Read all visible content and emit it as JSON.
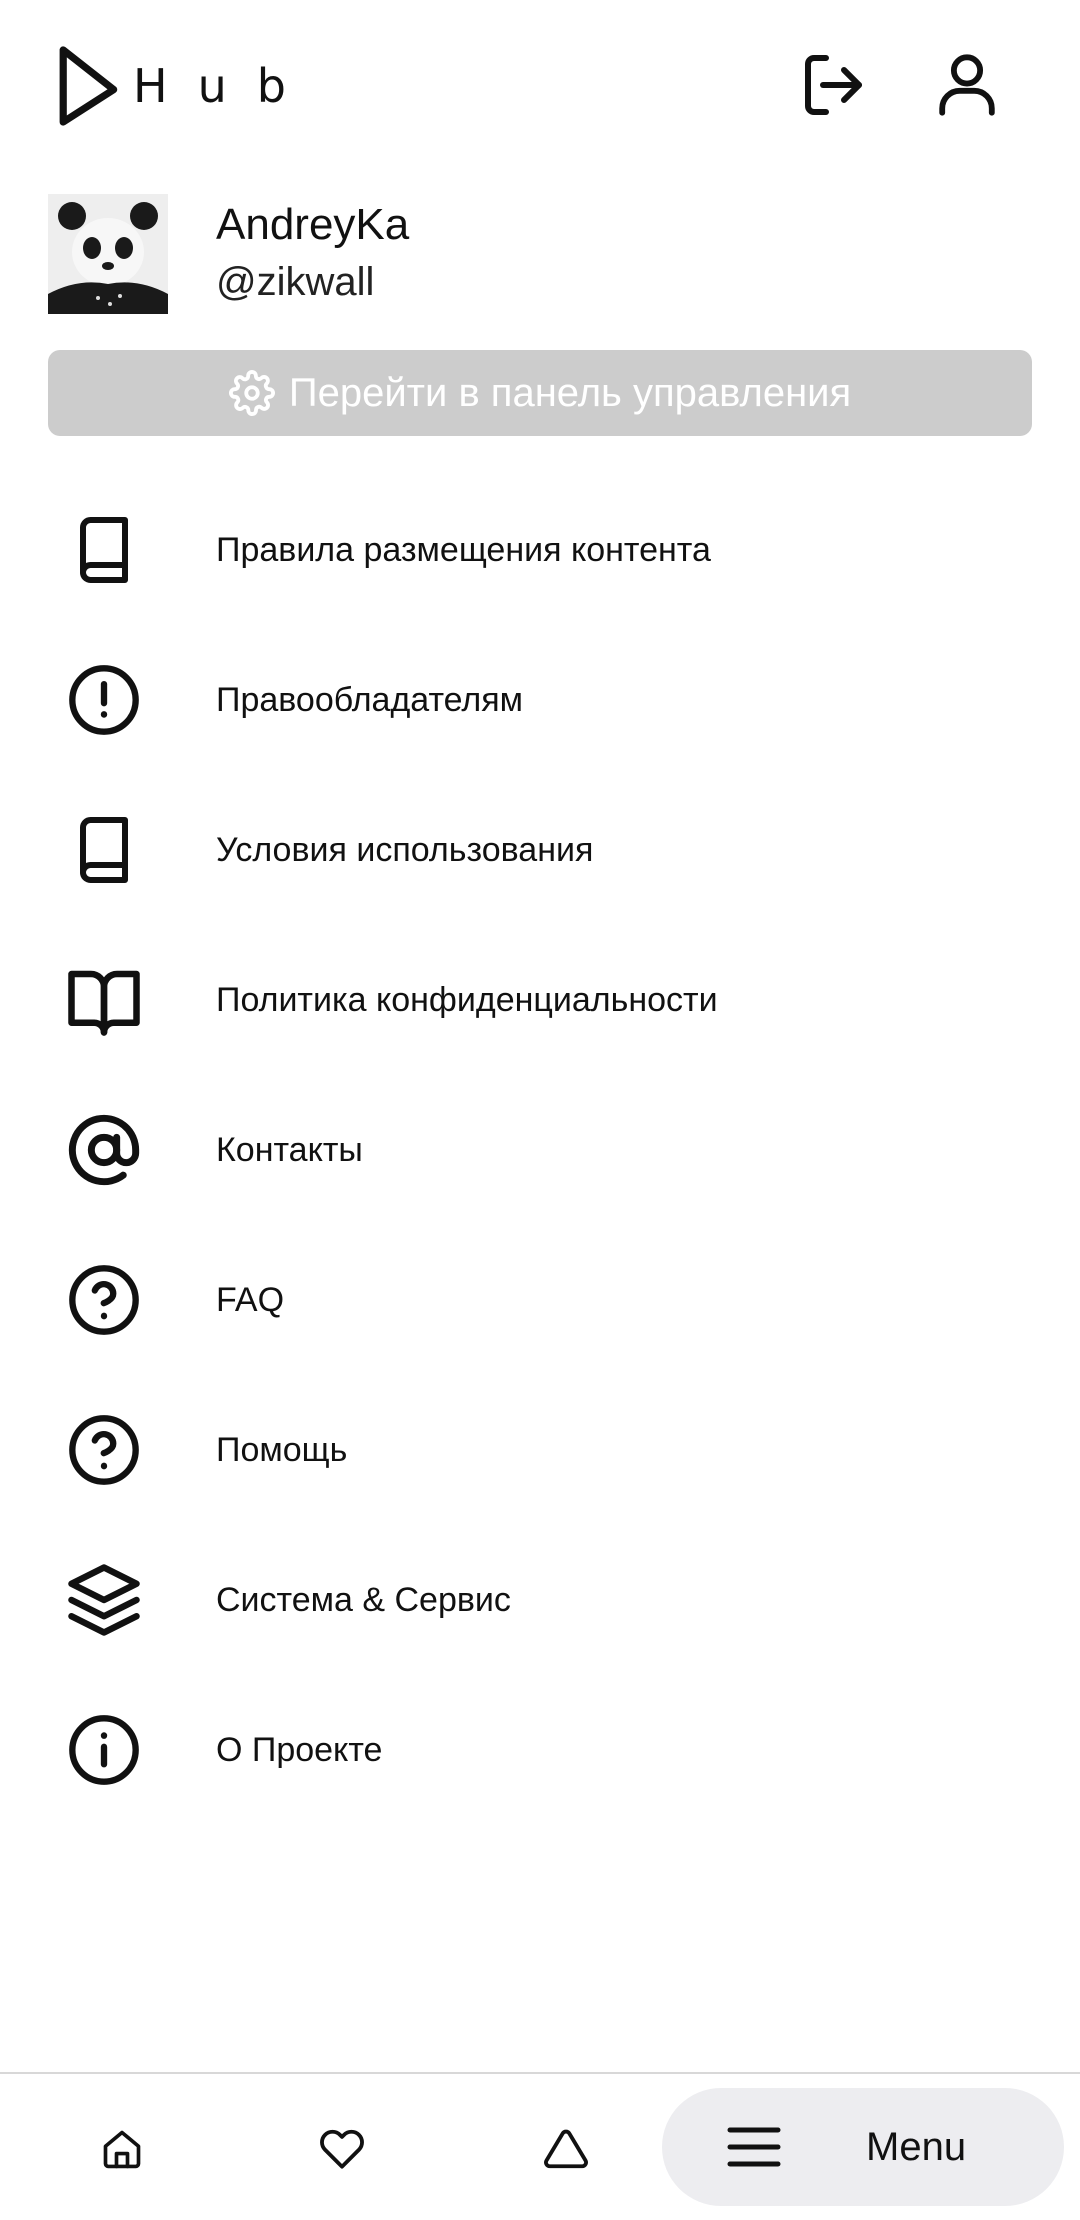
{
  "header": {
    "logo_text": "Hub",
    "logout_icon": "logout-icon",
    "profile_icon": "user-icon"
  },
  "profile": {
    "name": "AndreyKa",
    "handle": "@zikwall",
    "avatar": "panda-avatar"
  },
  "control_panel_button": {
    "label": "Перейти в панель управления",
    "icon": "gear-icon",
    "background": "#cccccc"
  },
  "menu": {
    "items": [
      {
        "label": "Правила размещения контента",
        "icon": "book-icon"
      },
      {
        "label": "Правообладателям",
        "icon": "alert-circle-icon"
      },
      {
        "label": "Условия использования",
        "icon": "book-icon"
      },
      {
        "label": "Политика конфиденциальности",
        "icon": "book-open-icon"
      },
      {
        "label": "Контакты",
        "icon": "at-sign-icon"
      },
      {
        "label": "FAQ",
        "icon": "help-circle-icon"
      },
      {
        "label": "Помощь",
        "icon": "help-circle-icon"
      },
      {
        "label": "Система & Сервис",
        "icon": "layers-icon"
      },
      {
        "label": "О Проекте",
        "icon": "info-icon"
      }
    ]
  },
  "bottom_nav": {
    "home_icon": "home-icon",
    "favorites_icon": "heart-icon",
    "triangle_icon": "triangle-icon",
    "menu_icon": "hamburger-icon",
    "menu_label": "Menu",
    "pill_color": "#ededf0"
  }
}
